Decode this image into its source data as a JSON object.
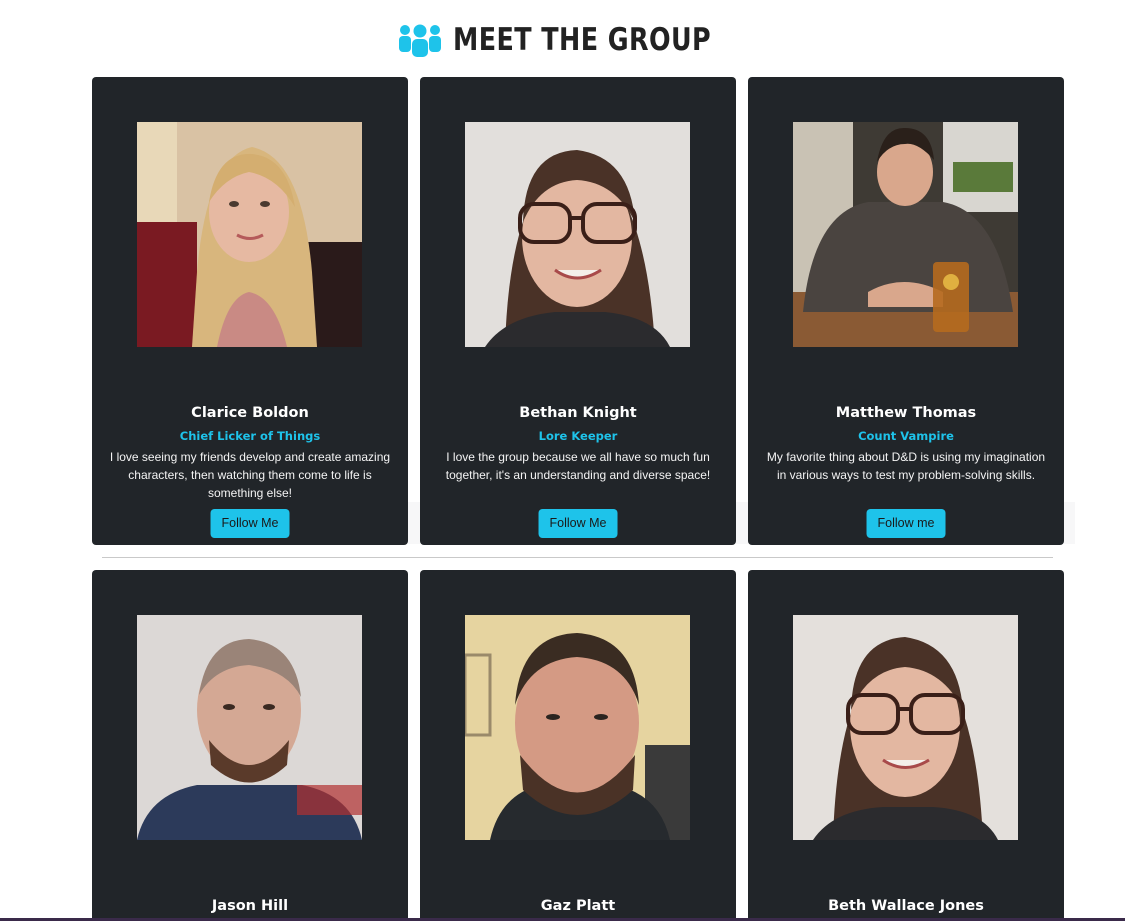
{
  "page": {
    "title": "MEET THE GROUP",
    "icon": "users-group-icon",
    "accent_color": "#1ec3ea",
    "card_color": "#212529"
  },
  "members": [
    {
      "name": "Clarice Boldon",
      "role": "Chief Licker of Things",
      "bio": "I love seeing my friends develop and create amazing characters, then watching them come to life is something else!",
      "button": "Follow Me",
      "photo": "portrait-photo"
    },
    {
      "name": "Bethan Knight",
      "role": "Lore Keeper",
      "bio": "I love the group because we all have so much fun together, it's an understanding and diverse space!",
      "button": "Follow Me",
      "photo": "portrait-photo"
    },
    {
      "name": "Matthew Thomas",
      "role": "Count Vampire",
      "bio": "My favorite thing about D&D is using my imagination in various ways to test my problem-solving skills.",
      "button": "Follow me",
      "photo": "portrait-photo"
    },
    {
      "name": "Jason Hill",
      "photo": "portrait-photo"
    },
    {
      "name": "Gaz Platt",
      "photo": "portrait-photo"
    },
    {
      "name": "Beth Wallace Jones",
      "photo": "portrait-photo"
    }
  ]
}
